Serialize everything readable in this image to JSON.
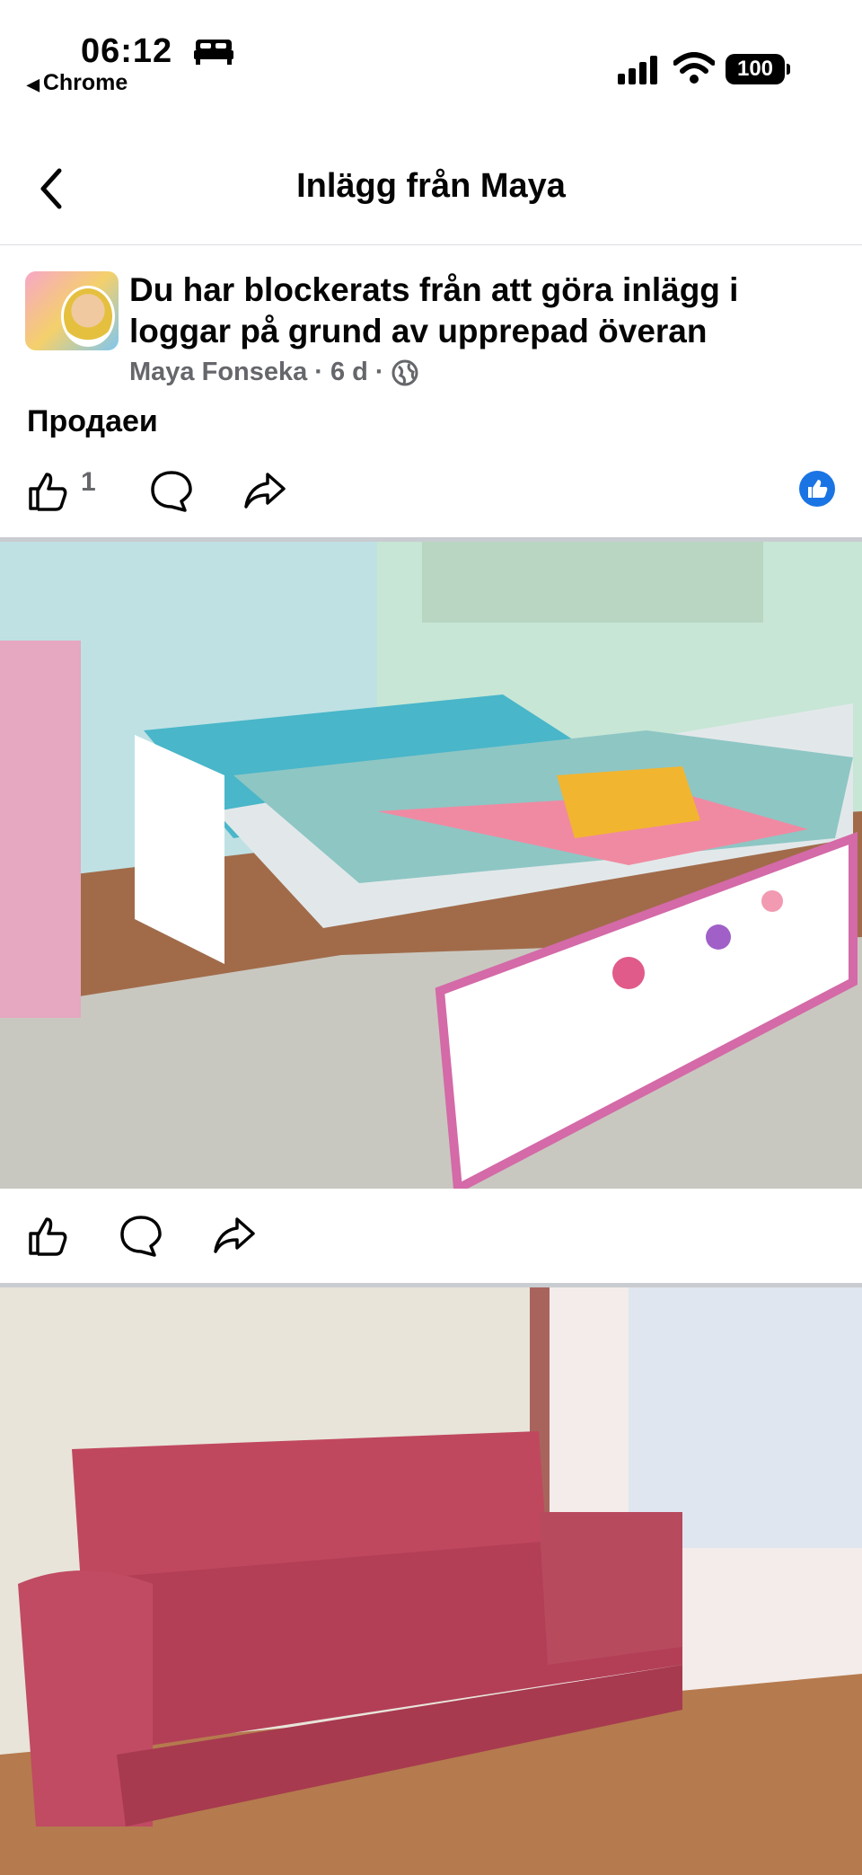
{
  "status_bar": {
    "time": "06:12",
    "back_app": "Chrome",
    "battery": "100",
    "icons": [
      "bed-icon",
      "signal-icon",
      "wifi-icon",
      "battery-icon"
    ]
  },
  "navbar": {
    "title": "Inlägg från Maya",
    "back_icon": "chevron-left-icon"
  },
  "post": {
    "title": "Du har blockerats från att göra inlägg i loggar på grund av upprepad överan",
    "author": "Maya Fonseka",
    "separator": "·",
    "age": "6 d",
    "privacy_icon": "globe-icon",
    "text": "Продаеи",
    "like_count": "1"
  },
  "photos": [
    {
      "alt": "bed-photo"
    },
    {
      "alt": "sofa-photo"
    }
  ],
  "colors": {
    "accent": "#1b74e4",
    "meta_text": "#65676b",
    "divider": "#c9ccd1"
  }
}
